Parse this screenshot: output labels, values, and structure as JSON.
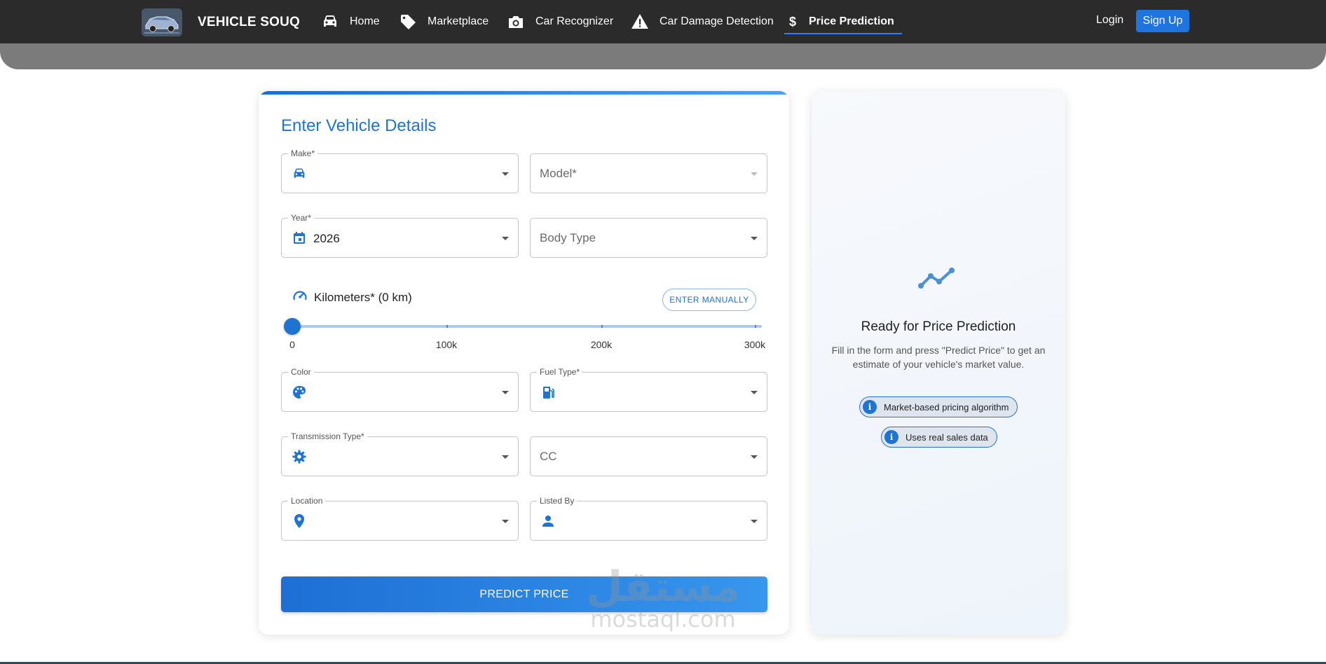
{
  "nav": {
    "brand": "VEHICLE SOUQ",
    "items": [
      {
        "label": "Home",
        "icon": "car-icon"
      },
      {
        "label": "Marketplace",
        "icon": "tag-icon"
      },
      {
        "label": "Car Recognizer",
        "icon": "camera-icon"
      },
      {
        "label": "Car Damage Detection",
        "icon": "warning-icon"
      },
      {
        "label": "Price Prediction",
        "icon": "dollar-icon",
        "active": true
      }
    ],
    "login": "Login",
    "signup": "Sign Up"
  },
  "form": {
    "title": "Enter Vehicle Details",
    "make": {
      "label": "Make*",
      "value": ""
    },
    "model": {
      "placeholder": "Model*"
    },
    "year": {
      "label": "Year*",
      "value": "2026"
    },
    "body_type": {
      "placeholder": "Body Type"
    },
    "kilometers": {
      "label": "Kilometers* (0 km)",
      "value": 0,
      "enter_manually": "ENTER MANUALLY",
      "marks": [
        "0",
        "100k",
        "200k",
        "300k"
      ]
    },
    "color": {
      "label": "Color",
      "value": ""
    },
    "fuel_type": {
      "label": "Fuel Type*",
      "value": ""
    },
    "transmission": {
      "label": "Transmission Type*",
      "value": ""
    },
    "cc": {
      "placeholder": "CC"
    },
    "location": {
      "label": "Location",
      "value": ""
    },
    "listed_by": {
      "label": "Listed By",
      "value": ""
    },
    "predict_button": "PREDICT PRICE"
  },
  "result": {
    "title": "Ready for Price Prediction",
    "description": "Fill in the form and press \"Predict Price\" to get an estimate of your vehicle's market value.",
    "chips": [
      "Market-based pricing algorithm",
      "Uses real sales data"
    ]
  },
  "watermark": {
    "arabic": "مستقل",
    "latin": "mostaql.com"
  },
  "colors": {
    "accent": "#1f73d1",
    "nav_bg": "#2b2b2b",
    "signup": "#1f75e0"
  }
}
